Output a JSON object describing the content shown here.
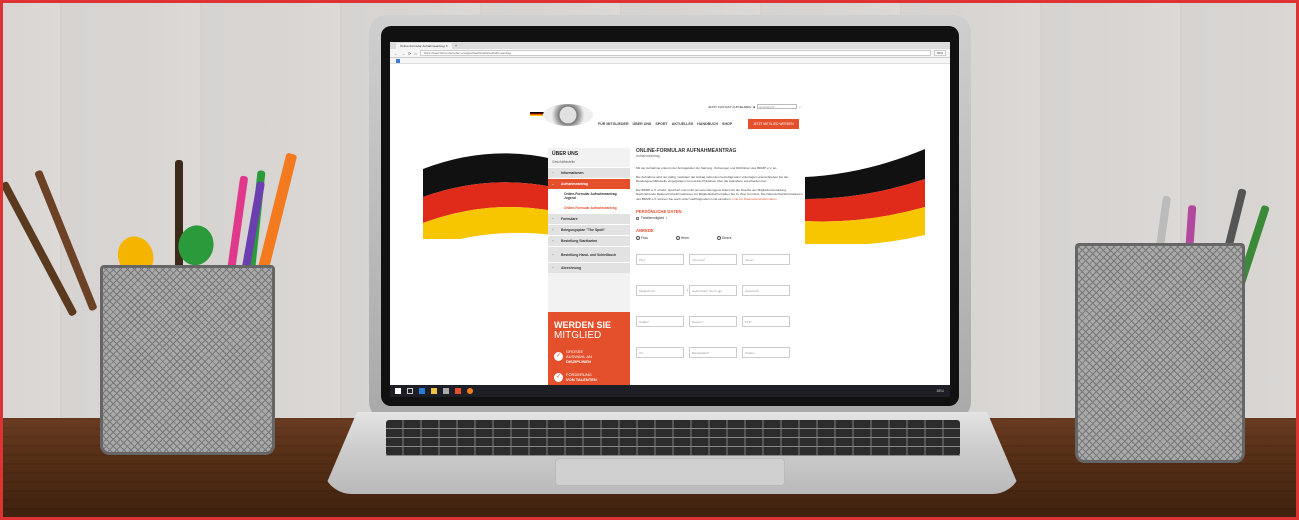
{
  "browser": {
    "tab_title": "Online-Formular Aufnahmeantrag ✕",
    "url": "https://www.bdmp.de/ueber-uns/geschaeftsstelle/aufnahmeantrag",
    "zoom": "90%"
  },
  "header": {
    "contact": "JETZT KONTAKT AUFNEHMEN",
    "search_placeholder": "Suchbegriff ...",
    "nav": [
      "FÜR MITGLIEDER",
      "ÜBER UNS",
      "SPORT",
      "AKTUELLES",
      "HANDBUCH",
      "SHOP"
    ],
    "cta": "JETZT MITGLIED WERDEN"
  },
  "sidebar": {
    "title": "ÜBER UNS",
    "subtitle": "Geschäftsstelle",
    "items": [
      {
        "label": "Informationen"
      },
      {
        "label": "Aufnahmeantrag"
      },
      {
        "label": "Formulare"
      },
      {
        "label": "Belegungsplan \"The Spott\""
      },
      {
        "label": "Bestellung Startkarten"
      },
      {
        "label": "Bestellung Hand- und Schießbuch"
      },
      {
        "label": "Abrechnung"
      }
    ],
    "subitems": [
      "Online-Formular Aufnahmeantrag Jugend",
      "Online-Formular Aufnahmeantrag"
    ],
    "promo": {
      "line1": "WERDEN SIE",
      "line2": "MITGLIED",
      "b1a": "GROSSE",
      "b1b": "AUSWAHL AN",
      "b1c": "DISZIPLINEN",
      "b2a": "FÖRDERUNG",
      "b2b": "VON TALENTEN"
    }
  },
  "content": {
    "title": "ONLINE-FORMULAR AUFNAHMEANTRAG",
    "subtitle": "Aufnahmeantrag",
    "p1": "Mit der Aufnahme erkennt der Antragsteller die Satzung, Ordnungen und Richtlinien des BDMP e.V. an.",
    "p2": "Die Aufnahme wird nur gültig, nachdem der Antrag nebst den beizufügenden Unterlagen unterschrieben bei der Bundesgeschäftsstelle eingegangen ist und das Präsidium über die Aufnahme entschieden hat.",
    "p3": "Die BDMP e.V. erhebt, speichert und nutzt personenbezogene Daten für die Zwecke der Mitgliederverwaltung. Nachstehende Datenschutzinformationen zur Mitgliedschaft erhalten Sie zu Ihrer Kenntnis. Die Datenschutzinformationen des BDMP e.V. können Sie auch unter nachfolgendem Link einsehen:",
    "link": "Link zur Datenschutzinformation",
    "section1": "PERSÖNLICHE DATEN",
    "checkbox": "Familienmitglied",
    "section2": "ANREDE",
    "radios": [
      "Frau",
      "Herrn",
      "Divers"
    ],
    "fields": [
      "Titel",
      "Vorname*",
      "Name*",
      "Mitglieds-Nr.",
      "Geburtstag* (tt.mm.jjjj)",
      "Geburtsort",
      "Straße*",
      "Hausnr.*",
      "PLZ*",
      "Ort",
      "Bundesland*",
      "Telefon"
    ]
  },
  "taskbar": {
    "tray": "DEU"
  }
}
